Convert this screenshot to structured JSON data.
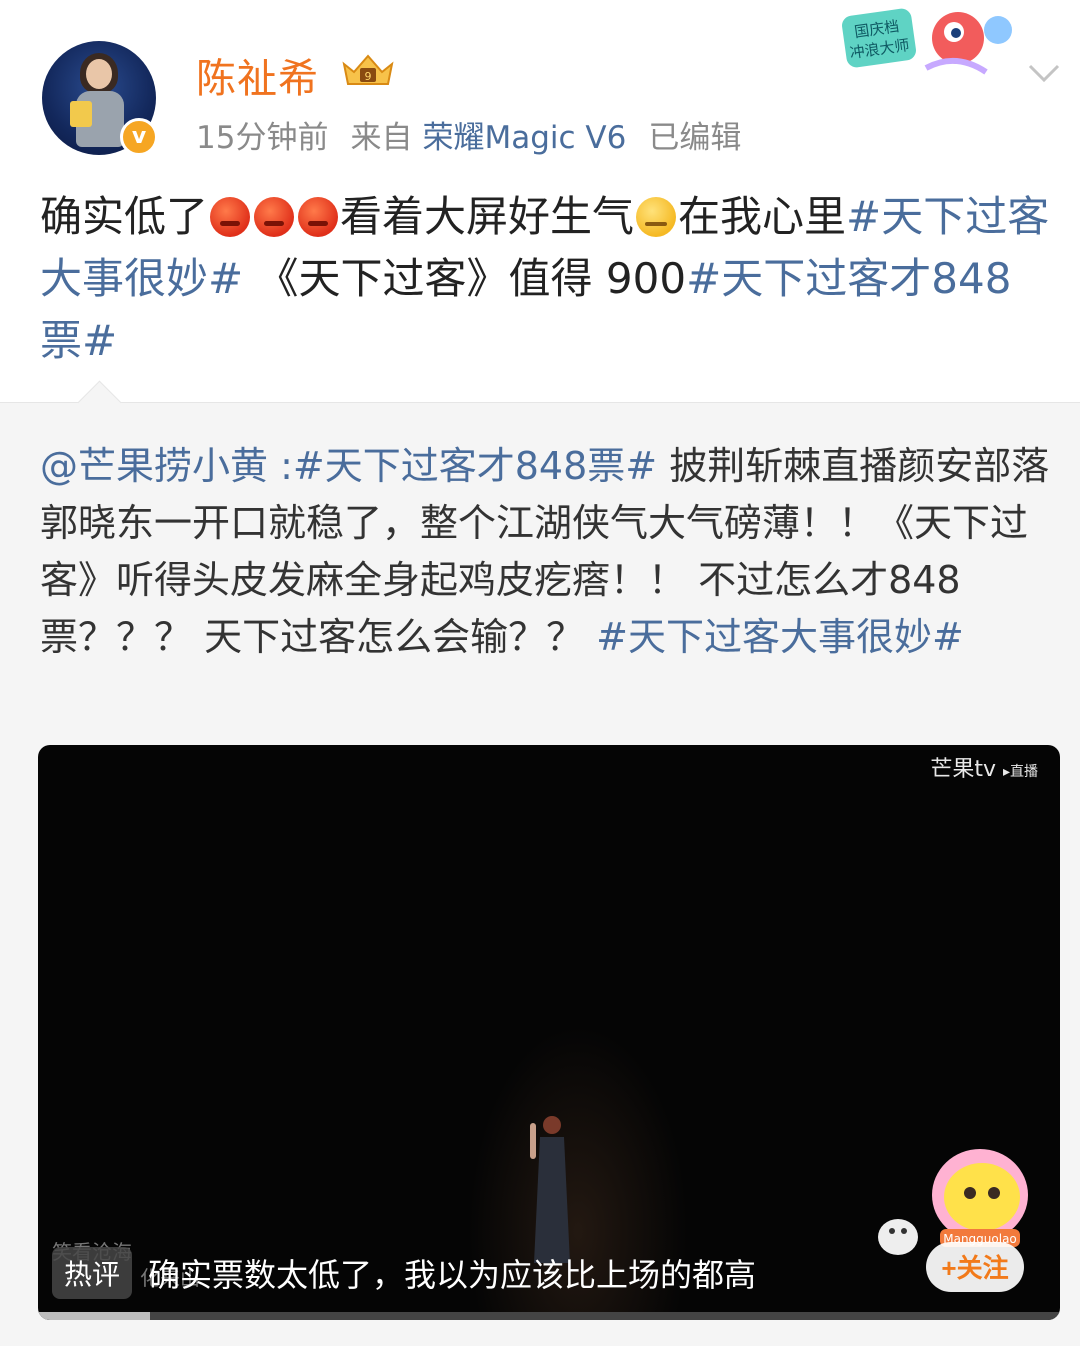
{
  "post": {
    "username": "陈祉希",
    "time": "15分钟前",
    "source_prefix": "来自",
    "source": "荣耀Magic V6",
    "edited": "已编辑",
    "text_a": "确实低了",
    "text_b": "看着大屏好生气",
    "text_c": "在我心里",
    "tag_1": "#天下过客大事很妙#",
    "text_d": " 《天下过客》值得 900",
    "tag_2": "#天下过客才848票#",
    "event_badge_line1": "国庆档",
    "event_badge_line2": "冲浪大师"
  },
  "repost": {
    "mention": "@芒果捞小黄",
    "colon": " :",
    "tag_1": "#天下过客才848票#",
    "body": " 披荆斩棘直播颜安部落郭晓东一开口就稳了，整个江湖侠气大气磅薄！！《天下过客》听得头皮发麻全身起鸡皮疙瘩！！ 不过怎么才848票？？？ 天下过客怎么会输？？ ",
    "tag_2": "#天下过客大事很妙#"
  },
  "video": {
    "watermark": "芒果tv",
    "watermark_sub": "▸直播",
    "corner_caption_1": "笑看沧海",
    "corner_caption_2": "化来山",
    "hot_label": "热评",
    "hot_comment": "确实票数太低了，我以为应该比上场的都高",
    "follow_label": "+关注",
    "mascot_text": "Mangguolao",
    "progress": 0.11
  },
  "colors": {
    "username": "#f0731f",
    "link": "#4a6d9c",
    "meta": "#8a8a8a"
  }
}
